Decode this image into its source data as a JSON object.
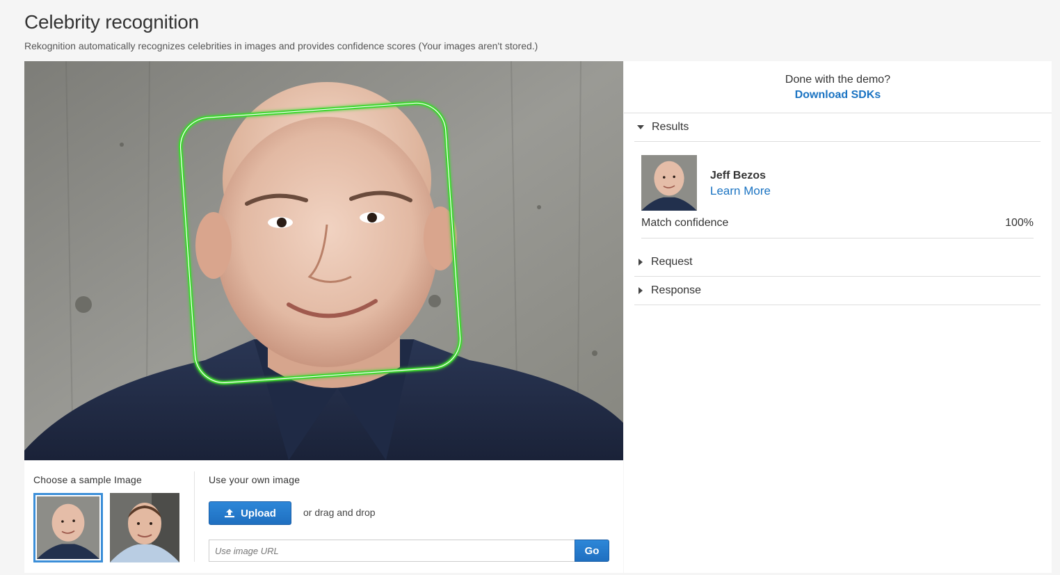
{
  "page": {
    "title": "Celebrity recognition",
    "subtitle": "Rekognition automatically recognizes celebrities in images and provides confidence scores (Your images aren't stored.)"
  },
  "samples": {
    "label": "Choose a sample Image",
    "selected_index": 0
  },
  "own_image": {
    "label": "Use your own image",
    "upload_label": "Upload",
    "drag_text": "or drag and drop",
    "url_placeholder": "Use image URL",
    "go_label": "Go"
  },
  "sdk": {
    "question": "Done with the demo?",
    "link_label": "Download SDKs"
  },
  "results": {
    "header": "Results",
    "expanded": true,
    "celebrity_name": "Jeff Bezos",
    "learn_more_label": "Learn More",
    "confidence_label": "Match confidence",
    "confidence_value": "100%"
  },
  "request": {
    "header": "Request",
    "expanded": false
  },
  "response": {
    "header": "Response",
    "expanded": false
  },
  "colors": {
    "accent_blue": "#1a73c2",
    "button_blue": "#2378c9",
    "face_box_green": "#3ed62e"
  }
}
